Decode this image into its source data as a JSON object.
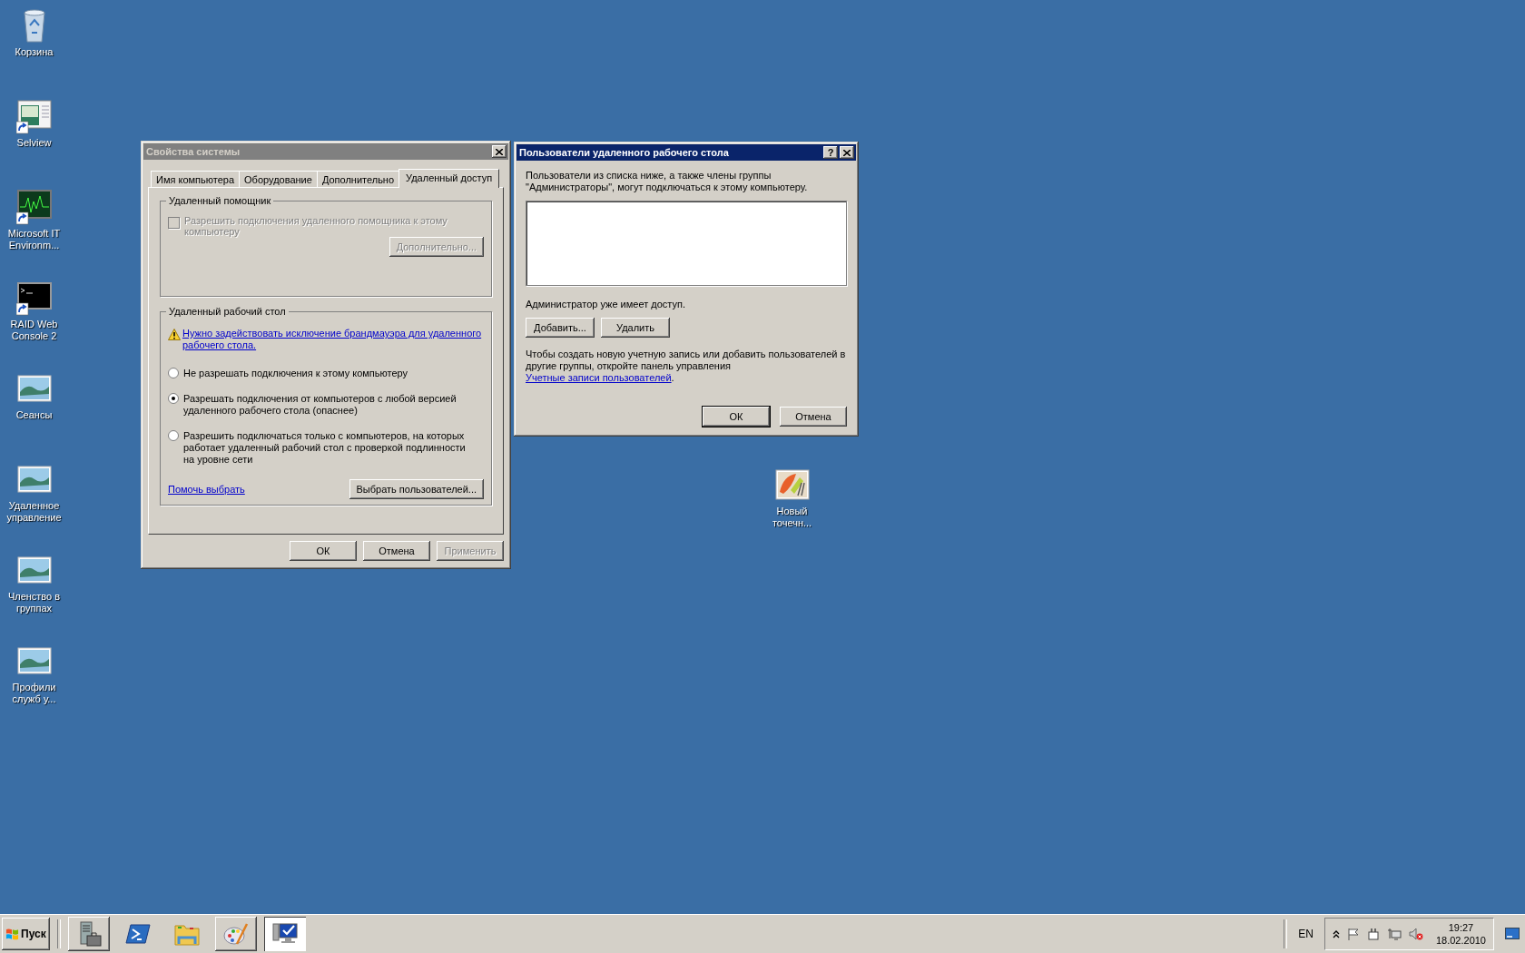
{
  "desktop_icons": [
    {
      "label": "Корзина",
      "kind": "recycle",
      "shortcut": false
    },
    {
      "label": "Selview",
      "kind": "window",
      "shortcut": true
    },
    {
      "label": "Microsoft IT Environm...",
      "kind": "monitor",
      "shortcut": true
    },
    {
      "label": "RAID Web Console 2",
      "kind": "console",
      "shortcut": true
    },
    {
      "label": "Сеансы",
      "kind": "picture",
      "shortcut": false
    },
    {
      "label": "Удаленное управление",
      "kind": "picture",
      "shortcut": false
    },
    {
      "label": "Членство в группах",
      "kind": "picture",
      "shortcut": false
    },
    {
      "label": "Профили служб у...",
      "kind": "picture",
      "shortcut": false
    }
  ],
  "desktop_file": {
    "label": "Новый точечн...",
    "kind": "paint"
  },
  "system_properties": {
    "title": "Свойства системы",
    "active": false,
    "tabs": [
      {
        "label": "Имя компьютера",
        "selected": false
      },
      {
        "label": "Оборудование",
        "selected": false
      },
      {
        "label": "Дополнительно",
        "selected": false
      },
      {
        "label": "Удаленный доступ",
        "selected": true
      }
    ],
    "remote_assistance": {
      "title": "Удаленный помощник",
      "checkbox": {
        "label": "Разрешить подключения удаленного помощника к этому компьютеру",
        "checked": false,
        "disabled": true
      },
      "button": {
        "label": "Дополнительно...",
        "disabled": true
      }
    },
    "remote_desktop": {
      "title": "Удаленный рабочий стол",
      "warning_link": "Нужно задействовать исключение брандмауэра для удаленного рабочего стола.",
      "options": [
        {
          "label": "Не разрешать подключения к этому компьютеру",
          "selected": false
        },
        {
          "label": "Разрешать подключения от компьютеров с любой версией удаленного рабочего стола (опаснее)",
          "selected": true
        },
        {
          "label": "Разрешить подключаться только с компьютеров, на которых работает удаленный рабочий стол с проверкой подлинности на уровне сети",
          "selected": false
        }
      ],
      "help_link": "Помочь выбрать",
      "select_button": "Выбрать пользователей..."
    },
    "buttons": [
      {
        "label": "ОК",
        "disabled": false
      },
      {
        "label": "Отмена",
        "disabled": false
      },
      {
        "label": "Применить",
        "disabled": true
      }
    ]
  },
  "remote_users": {
    "title": "Пользователи удаленного рабочего стола",
    "active": true,
    "help_button": "?",
    "intro": "Пользователи из списка ниже, а также члены группы \"Администраторы\", могут подключаться к этому компьютеру.",
    "note": "Администратор уже имеет доступ.",
    "list_buttons": [
      "Добавить...",
      "Удалить"
    ],
    "info_before": "Чтобы создать новую учетную запись или добавить пользователей в другие группы, откройте панель управления ",
    "info_link": "Учетные записи пользователей",
    "info_after": ".",
    "buttons": [
      {
        "label": "ОК",
        "default": true
      },
      {
        "label": "Отмена",
        "default": false
      }
    ]
  },
  "taskbar": {
    "start": "Пуск",
    "buttons": [
      {
        "kind": "server",
        "running": true,
        "selected": false
      },
      {
        "kind": "shell",
        "running": false,
        "selected": false
      },
      {
        "kind": "folder",
        "running": false,
        "selected": false
      },
      {
        "kind": "paint",
        "running": true,
        "selected": false
      },
      {
        "kind": "monitor",
        "selected": true
      }
    ],
    "language": "EN",
    "time": "19:27",
    "date": "18.02.2010"
  }
}
